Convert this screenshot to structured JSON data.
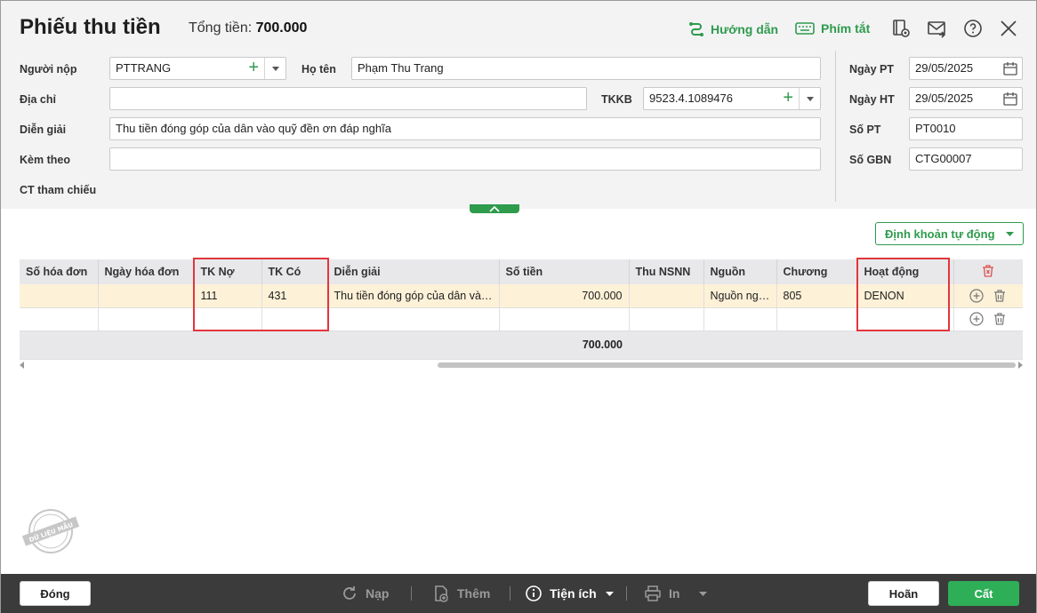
{
  "header": {
    "title": "Phiếu thu tiền",
    "total_label": "Tổng tiền:",
    "total_value": "700.000",
    "guide": "Hướng dẫn",
    "shortcuts": "Phím tắt"
  },
  "form": {
    "payer_label": "Người nộp",
    "payer_value": "PTTRANG",
    "name_label": "Họ tên",
    "name_value": "Phạm Thu Trang",
    "address_label": "Địa chỉ",
    "address_value": "",
    "tkkb_label": "TKKB",
    "tkkb_value": "9523.4.1089476",
    "desc_label": "Diễn giải",
    "desc_value": "Thu tiền đóng góp của dân vào quỹ đền ơn đáp nghĩa",
    "attach_label": "Kèm theo",
    "attach_value": "",
    "ref_label": "CT tham chiếu",
    "date_pt_label": "Ngày PT",
    "date_pt_value": "29/05/2025",
    "date_ht_label": "Ngày HT",
    "date_ht_value": "29/05/2025",
    "so_pt_label": "Số PT",
    "so_pt_value": "PT0010",
    "so_gbn_label": "Số GBN",
    "so_gbn_value": "CTG00007"
  },
  "auto_button": "Định khoản tự động",
  "grid": {
    "columns": [
      "Số hóa đơn",
      "Ngày hóa đơn",
      "TK Nợ",
      "TK Có",
      "Diễn giải",
      "Số tiền",
      "Thu NSNN",
      "Nguồn",
      "Chương",
      "Hoạt động"
    ],
    "rows": [
      [
        "",
        "",
        "111",
        "431",
        "Thu tiền đóng góp của dân vào quỹ đền ơn đáp nghĩa",
        "700.000",
        "",
        "Nguồn ngân sách",
        "805",
        "DENON"
      ],
      [
        "",
        "",
        "",
        "",
        "",
        "",
        "",
        "",
        "",
        ""
      ]
    ],
    "total": "700.000"
  },
  "stamp_text": "DỮ LIỆU MẪU",
  "footer": {
    "close": "Đóng",
    "reload": "Nạp",
    "add": "Thêm",
    "utilities": "Tiện ích",
    "print": "In",
    "cancel": "Hoãn",
    "save": "Cất"
  },
  "colors": {
    "accent": "#2e9b4d",
    "highlight": "#e2363c",
    "selected_row": "#fdf1d8",
    "footer": "#3b3b3b"
  }
}
